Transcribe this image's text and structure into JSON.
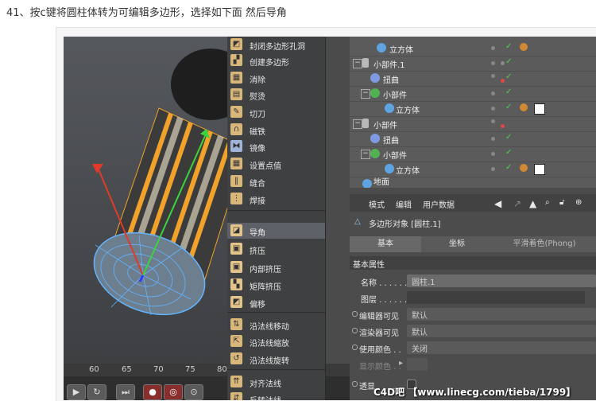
{
  "heading": "41、按c键将圆柱体转为可编辑多边形，选择如下面 然后导角",
  "menu": {
    "items": [
      {
        "label": "封闭多边形孔洞",
        "icon": "close-hole-icon"
      },
      {
        "label": "创建多边形",
        "icon": "create-polygon-icon"
      },
      {
        "label": "消除",
        "icon": "dissolve-icon"
      },
      {
        "label": "熨烫",
        "icon": "iron-icon"
      },
      {
        "label": "切刀",
        "icon": "knife-icon"
      },
      {
        "label": "磁铁",
        "icon": "magnet-icon"
      },
      {
        "label": "镜像",
        "icon": "mirror-icon"
      },
      {
        "label": "设置点值",
        "icon": "set-point-value-icon"
      },
      {
        "label": "缝合",
        "icon": "stitch-icon"
      },
      {
        "label": "焊接",
        "icon": "weld-icon"
      },
      {
        "label": "导角",
        "icon": "bevel-icon"
      },
      {
        "label": "挤压",
        "icon": "extrude-icon"
      },
      {
        "label": "内部挤压",
        "icon": "extrude-inner-icon"
      },
      {
        "label": "矩阵挤压",
        "icon": "matrix-extrude-icon"
      },
      {
        "label": "偏移",
        "icon": "smooth-shift-icon"
      },
      {
        "label": "沿法线移动",
        "icon": "normal-move-icon"
      },
      {
        "label": "沿法线缩放",
        "icon": "normal-scale-icon"
      },
      {
        "label": "沿法线旋转",
        "icon": "normal-rotate-icon"
      },
      {
        "label": "对齐法线",
        "icon": "align-normals-icon"
      },
      {
        "label": "反转法线",
        "icon": "reverse-normals-icon"
      }
    ],
    "selected": "导角"
  },
  "objects": {
    "rows": [
      {
        "name": "立方体",
        "type": "cube"
      },
      {
        "name": "小部件.1",
        "type": "null"
      },
      {
        "name": "扭曲",
        "type": "deformer"
      },
      {
        "name": "小部件",
        "type": "cloner"
      },
      {
        "name": "立方体",
        "type": "cube"
      },
      {
        "name": "小部件",
        "type": "null"
      },
      {
        "name": "扭曲",
        "type": "deformer"
      },
      {
        "name": "小部件",
        "type": "cloner"
      },
      {
        "name": "立方体",
        "type": "cube"
      },
      {
        "name": "地面",
        "type": "floor"
      }
    ]
  },
  "attributes": {
    "menu": [
      "模式",
      "编辑",
      "用户数据"
    ],
    "object_title": "多边形对象 [圆柱.1]",
    "tabs": [
      "基本",
      "坐标",
      "平滑着色(Phong)"
    ],
    "active_tab": "基本",
    "section": "基本属性",
    "props": [
      {
        "label": "名称 . . . . . .",
        "value": "圆柱.1"
      },
      {
        "label": "图层 . . . . . .",
        "value": ""
      },
      {
        "label": "编辑器可见",
        "value": "默认"
      },
      {
        "label": "渲染器可见",
        "value": "默认"
      },
      {
        "label": "使用颜色 . .",
        "value": "关闭"
      },
      {
        "label": "显示颜色 . .",
        "value": ""
      },
      {
        "label": "透显 . . . . . .",
        "value": ""
      }
    ]
  },
  "timeline": {
    "ticks": [
      "60",
      "65",
      "70",
      "75",
      "80"
    ]
  },
  "watermark": "C4D吧 【www.linecg.com/tieba/1799】",
  "colors": {
    "accent_orange": "#f0a22a",
    "wire_blue": "#63b4ff",
    "selected_menu": "#5d6066"
  }
}
